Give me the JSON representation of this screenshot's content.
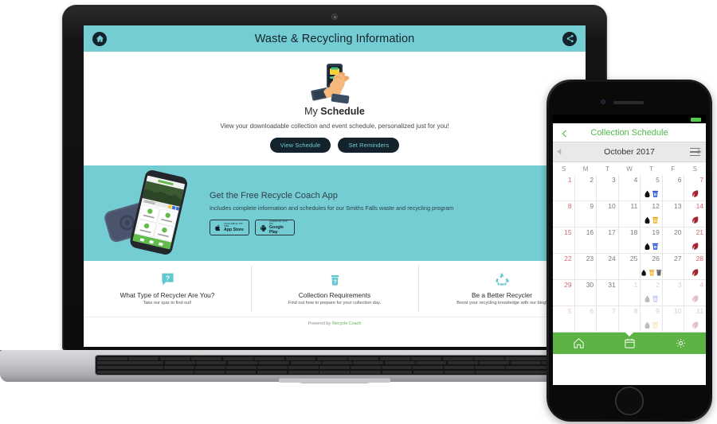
{
  "laptop": {
    "header": {
      "title": "Waste & Recycling Information",
      "home_icon": "home-icon",
      "share_icon": "share-icon",
      "bg": "#74cdd3"
    },
    "hero": {
      "art_icon": "hand-holding-phone-illustration",
      "title_light": "My ",
      "title_bold": "Schedule",
      "description": "View your downloadable collection and event schedule, personalized just for you!",
      "buttons": [
        {
          "label": "View Schedule"
        },
        {
          "label": "Set Reminders"
        }
      ],
      "button_bg": "#14222c",
      "button_fg": "#6fc9d1"
    },
    "promo": {
      "art_icon": "two-smartphones-illustration",
      "heading": "Get the Free Recycle Coach App",
      "subheading": "Includes complete information and schedules for our Smiths Falls waste and recycling program",
      "badges": [
        {
          "icon": "apple-icon",
          "small": "AVAILABLE ON THE",
          "big": "App Store"
        },
        {
          "icon": "android-icon",
          "small": "ANDROID APP ON",
          "big": "Google Play"
        }
      ],
      "bg": "#74cdd3"
    },
    "cards": [
      {
        "icon": "question-speech-bubble-icon",
        "title": "What Type of Recycler Are You?",
        "subtitle": "Take our quiz to find out!"
      },
      {
        "icon": "question-trash-bin-icon",
        "title": "Collection Requirements",
        "subtitle": "Find out how to prepare for your collection day."
      },
      {
        "icon": "recycle-icon",
        "title": "Be a Better Recycler",
        "subtitle": "Boost your recycling knowledge with our blog!"
      }
    ],
    "card_icon_color": "#62c6d0",
    "footer": {
      "prefix": "Powered by",
      "brand": "Recycle Coach",
      "brand_color": "#5ab14f"
    }
  },
  "phone": {
    "nav": {
      "title": "Collection Schedule",
      "back_icon": "chevron-left-icon",
      "accent": "#4fb94a"
    },
    "calendar": {
      "month": "October 2017",
      "prev_icon": "triangle-left-icon",
      "next_icon": "triangle-right-icon",
      "menu_icon": "hamburger-menu-icon",
      "weekdays": [
        "S",
        "M",
        "T",
        "W",
        "T",
        "F",
        "S"
      ],
      "weeks": [
        [
          {
            "n": "1",
            "we": true,
            "out": false,
            "icons": []
          },
          {
            "n": "2",
            "we": false,
            "out": false,
            "icons": []
          },
          {
            "n": "3",
            "we": false,
            "out": false,
            "icons": []
          },
          {
            "n": "4",
            "we": false,
            "out": false,
            "icons": []
          },
          {
            "n": "5",
            "we": false,
            "out": false,
            "icons": [
              "garbage-bag",
              "blue-bin"
            ]
          },
          {
            "n": "6",
            "we": false,
            "out": false,
            "icons": []
          },
          {
            "n": "7",
            "we": true,
            "out": false,
            "icons": [
              "leaf"
            ]
          }
        ],
        [
          {
            "n": "8",
            "we": true,
            "out": false,
            "icons": []
          },
          {
            "n": "9",
            "we": false,
            "out": false,
            "icons": []
          },
          {
            "n": "10",
            "we": false,
            "out": false,
            "icons": []
          },
          {
            "n": "11",
            "we": false,
            "out": false,
            "icons": []
          },
          {
            "n": "12",
            "we": false,
            "out": false,
            "icons": [
              "garbage-bag",
              "yellow-bin"
            ]
          },
          {
            "n": "13",
            "we": false,
            "out": false,
            "icons": []
          },
          {
            "n": "14",
            "we": true,
            "out": false,
            "icons": [
              "leaf"
            ]
          }
        ],
        [
          {
            "n": "15",
            "we": true,
            "out": false,
            "icons": []
          },
          {
            "n": "16",
            "we": false,
            "out": false,
            "icons": []
          },
          {
            "n": "17",
            "we": false,
            "out": false,
            "icons": []
          },
          {
            "n": "18",
            "we": false,
            "out": false,
            "icons": []
          },
          {
            "n": "19",
            "we": false,
            "out": false,
            "icons": [
              "garbage-bag",
              "blue-bin"
            ]
          },
          {
            "n": "20",
            "we": false,
            "out": false,
            "icons": []
          },
          {
            "n": "21",
            "we": true,
            "out": false,
            "icons": [
              "leaf"
            ]
          }
        ],
        [
          {
            "n": "22",
            "we": true,
            "out": false,
            "icons": []
          },
          {
            "n": "23",
            "we": false,
            "out": false,
            "icons": []
          },
          {
            "n": "24",
            "we": false,
            "out": false,
            "icons": []
          },
          {
            "n": "25",
            "we": false,
            "out": false,
            "icons": []
          },
          {
            "n": "26",
            "we": false,
            "out": false,
            "icons": [
              "garbage-bag",
              "yellow-bin",
              "grey-bin"
            ]
          },
          {
            "n": "27",
            "we": false,
            "out": false,
            "icons": []
          },
          {
            "n": "28",
            "we": true,
            "out": false,
            "icons": [
              "leaf"
            ]
          }
        ],
        [
          {
            "n": "29",
            "we": true,
            "out": false,
            "icons": []
          },
          {
            "n": "30",
            "we": false,
            "out": false,
            "icons": []
          },
          {
            "n": "31",
            "we": false,
            "out": false,
            "icons": []
          },
          {
            "n": "1",
            "we": false,
            "out": true,
            "icons": []
          },
          {
            "n": "2",
            "we": false,
            "out": true,
            "icons": [
              "garbage-bag",
              "blue-bin"
            ]
          },
          {
            "n": "3",
            "we": false,
            "out": true,
            "icons": []
          },
          {
            "n": "4",
            "we": true,
            "out": true,
            "icons": [
              "leaf"
            ]
          }
        ],
        [
          {
            "n": "5",
            "we": true,
            "out": true,
            "icons": []
          },
          {
            "n": "6",
            "we": false,
            "out": true,
            "icons": []
          },
          {
            "n": "7",
            "we": false,
            "out": true,
            "icons": []
          },
          {
            "n": "8",
            "we": false,
            "out": true,
            "icons": []
          },
          {
            "n": "9",
            "we": false,
            "out": true,
            "icons": [
              "garbage-bag",
              "yellow-bin"
            ]
          },
          {
            "n": "10",
            "we": false,
            "out": true,
            "icons": []
          },
          {
            "n": "11",
            "we": true,
            "out": true,
            "icons": [
              "leaf"
            ]
          }
        ]
      ]
    },
    "tabs": [
      {
        "icon": "home-icon",
        "active": false
      },
      {
        "icon": "calendar-icon",
        "active": true
      },
      {
        "icon": "gear-icon",
        "active": false
      }
    ],
    "tabbar_bg": "#5cb343"
  }
}
